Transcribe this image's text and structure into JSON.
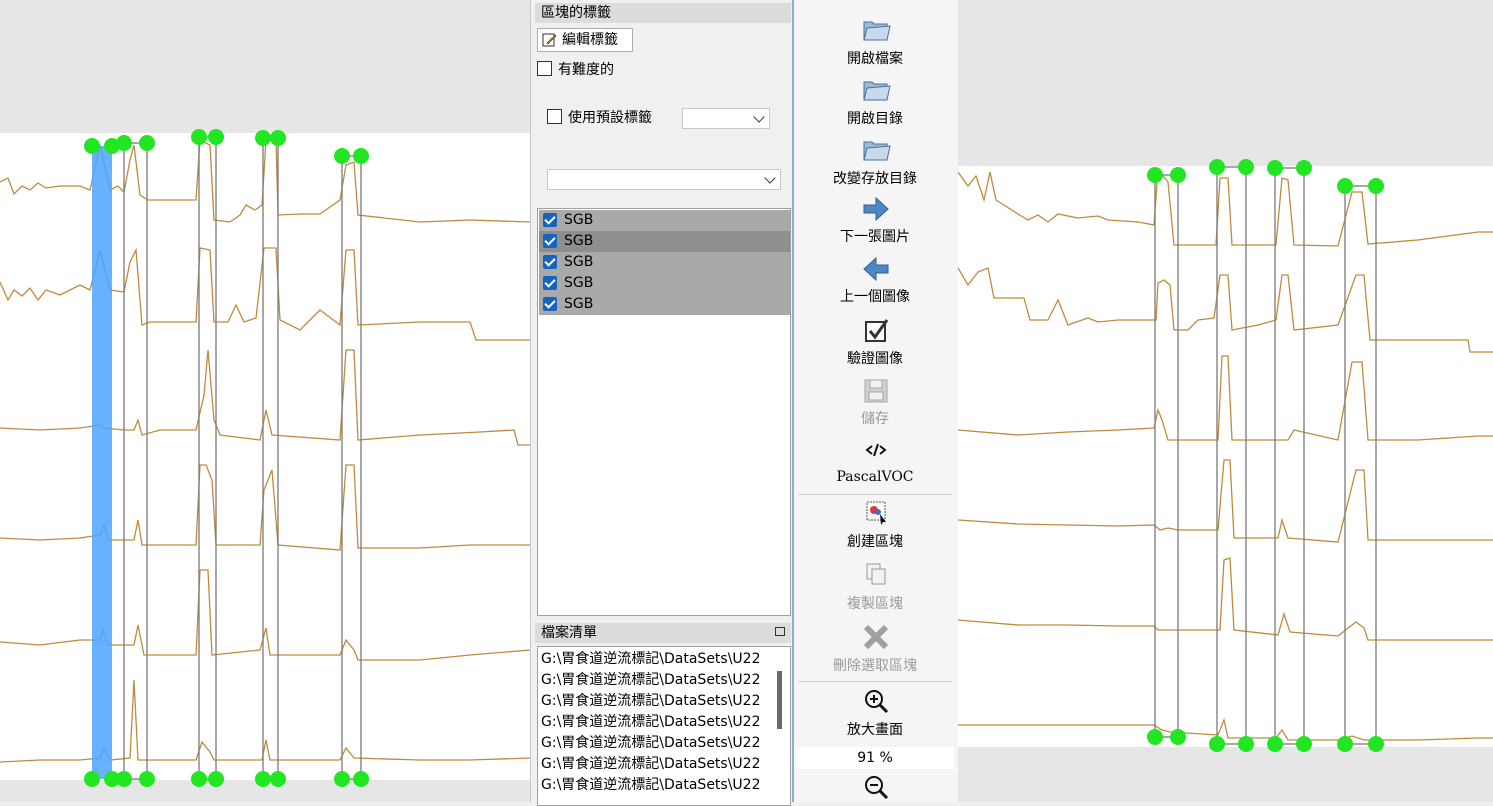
{
  "label_panel": {
    "title": "區塊的標籤",
    "edit_label_button": "編輯標籤",
    "difficult_checkbox": "有難度的",
    "use_default_label_checkbox": "使用預設標籤",
    "default_label_value": "",
    "label_filter_value": "",
    "labels": [
      {
        "text": "SGB",
        "checked": true,
        "selected": false
      },
      {
        "text": "SGB",
        "checked": true,
        "selected": true
      },
      {
        "text": "SGB",
        "checked": true,
        "selected": false
      },
      {
        "text": "SGB",
        "checked": true,
        "selected": false
      },
      {
        "text": "SGB",
        "checked": true,
        "selected": false
      }
    ]
  },
  "file_panel": {
    "title": "檔案清單",
    "files": [
      "G:\\胃食道逆流標記\\DataSets\\U22",
      "G:\\胃食道逆流標記\\DataSets\\U22",
      "G:\\胃食道逆流標記\\DataSets\\U22",
      "G:\\胃食道逆流標記\\DataSets\\U22",
      "G:\\胃食道逆流標記\\DataSets\\U22",
      "G:\\胃食道逆流標記\\DataSets\\U22",
      "G:\\胃食道逆流標記\\DataSets\\U22"
    ]
  },
  "toolbar": {
    "open_file": "開啟檔案",
    "open_dir": "開啟目錄",
    "change_save_dir": "改變存放目錄",
    "next_image": "下一張圖片",
    "prev_image": "上一個圖像",
    "verify_image": "驗證圖像",
    "save": "儲存",
    "format": "PascalVOC",
    "create_box": "創建區塊",
    "duplicate_box": "複製區塊",
    "delete_box": "刪除選取區塊",
    "zoom_in": "放大畫面",
    "zoom_level": "91 %"
  },
  "colors": {
    "trace": "#c08a3e",
    "handle": "#22e622",
    "selected_box": "#4da3ff",
    "box_line": "#7a7a7a",
    "canvas_bg": "#e6e6e6"
  }
}
